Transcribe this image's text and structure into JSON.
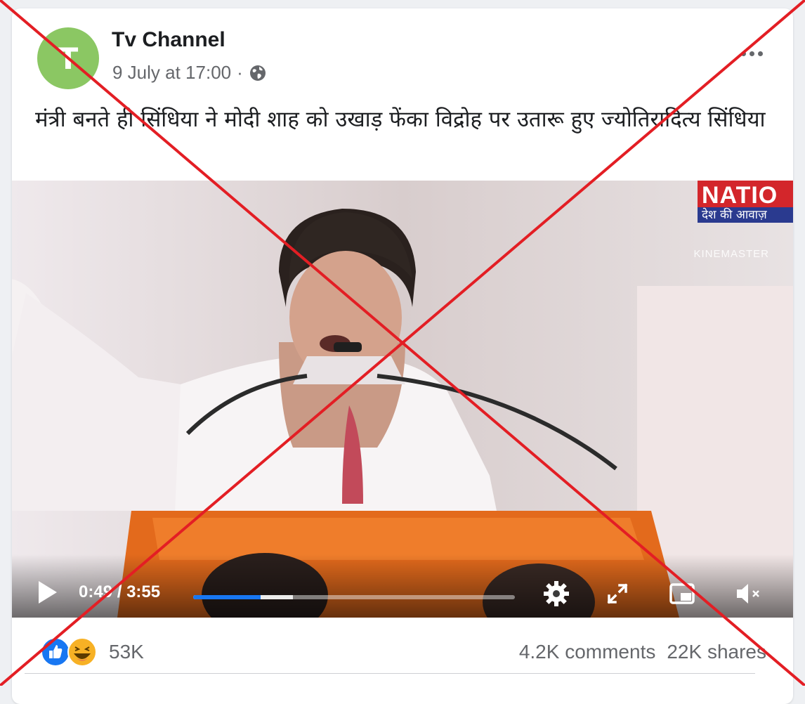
{
  "post": {
    "avatar_letter": "T",
    "author": "Tv Channel",
    "date": "9 July at 17:00",
    "separator": "·",
    "caption": "मंत्री बनते ही सिंधिया ने मोदी शाह को उखाड़ फेंका विद्रोह पर उतारू हुए ज्योतिरादित्य सिंधिया"
  },
  "video": {
    "channel_logo_top": "NATIO",
    "channel_logo_bottom": "देश की आवाज़",
    "watermark": "KINEMASTER",
    "time_current": "0:49",
    "time_separator": " / ",
    "time_total": "3:55",
    "progress_played": 0.21,
    "progress_buffered": 0.31
  },
  "footer": {
    "reaction_count": "53K",
    "comments": "4.2K comments",
    "shares": "22K shares"
  },
  "colors": {
    "avatar": "#8bc763",
    "progress": "#1877f2",
    "strike": "#e31e24"
  },
  "icons": [
    "globe-icon",
    "more-options-icon",
    "play-icon",
    "settings-icon",
    "fullscreen-icon",
    "miniplayer-icon",
    "mute-icon",
    "like-reaction-icon",
    "haha-reaction-icon"
  ]
}
